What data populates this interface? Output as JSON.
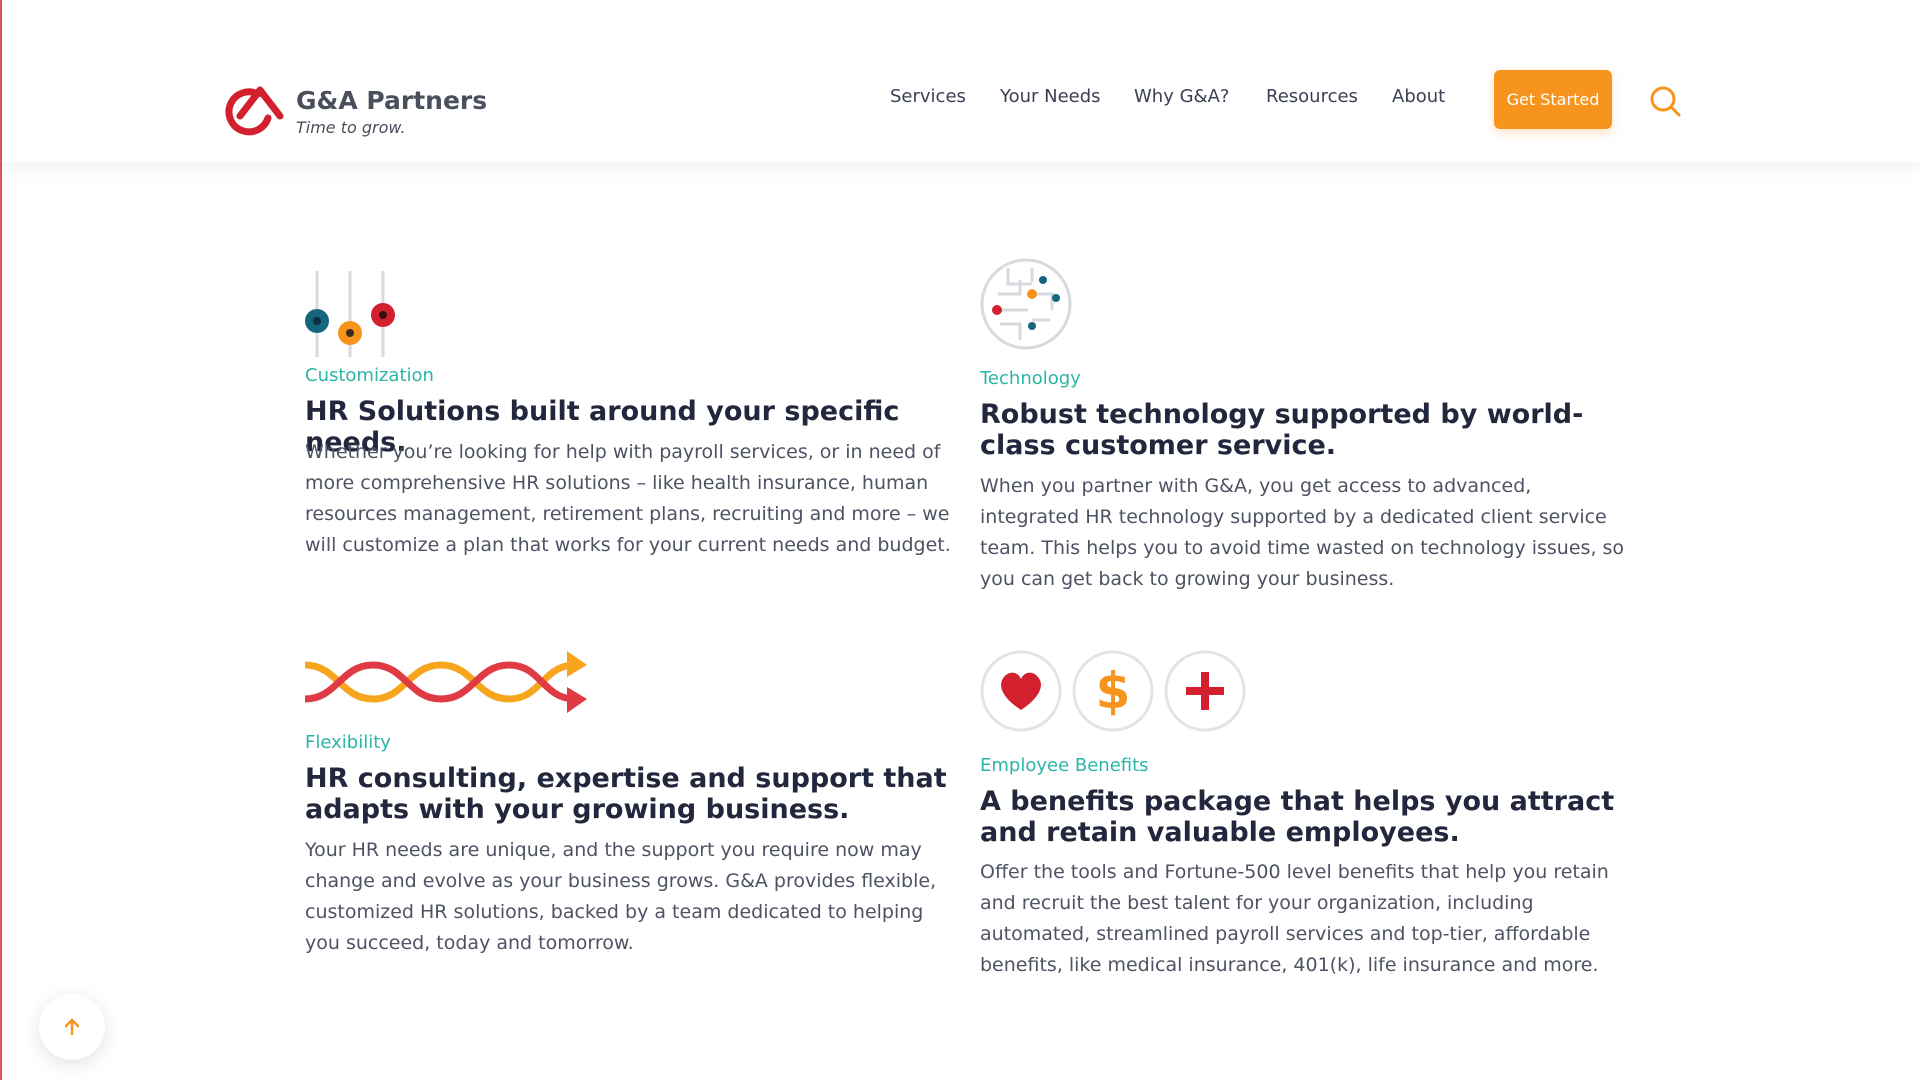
{
  "brand": {
    "name": "G&A Partners",
    "tagline": "Time to grow."
  },
  "nav": {
    "items": [
      "Services",
      "Your Needs",
      "Why G&A?",
      "Resources",
      "About"
    ],
    "cta_label": "Get Started"
  },
  "features": [
    {
      "icon": "sliders-icon",
      "label": "Customization",
      "heading": "HR Solutions built around your specific needs.",
      "body": "Whether you’re looking for help with payroll services, or in need of more comprehensive HR solutions – like health insurance, human resources management, retirement plans, recruiting and more – we will customize a plan that works for your current needs and budget."
    },
    {
      "icon": "circuit-icon",
      "label": "Technology",
      "heading": "Robust technology supported by world-class customer service.",
      "body": "When you partner with G&A, you get access to advanced, integrated HR technology supported by a dedicated client service team. This helps you to avoid time wasted on technology issues, so you can get back to growing your business."
    },
    {
      "icon": "intertwined-arrows-icon",
      "label": "Flexibility",
      "heading": "HR consulting, expertise and support that adapts with your growing business.",
      "body": "Your HR needs are unique, and the support you require now may change and evolve as your business grows. G&A provides flexible, customized HR solutions, backed by a team dedicated to helping you succeed, today and tomorrow."
    },
    {
      "icon": "benefits-icons",
      "label": "Employee Benefits",
      "heading": "A benefits package that helps you attract and retain valuable employees.",
      "body": "Offer the tools and Fortune-500 level benefits that help you retain and recruit the best talent for your organization, including automated, streamlined payroll services and top-tier, affordable benefits, like medical insurance, 401(k), life insurance and more."
    }
  ],
  "colors": {
    "accent_orange": "#f7941d",
    "brand_red": "#d3202f",
    "label_teal": "#2bb5a5",
    "dark_teal": "#15657d"
  }
}
